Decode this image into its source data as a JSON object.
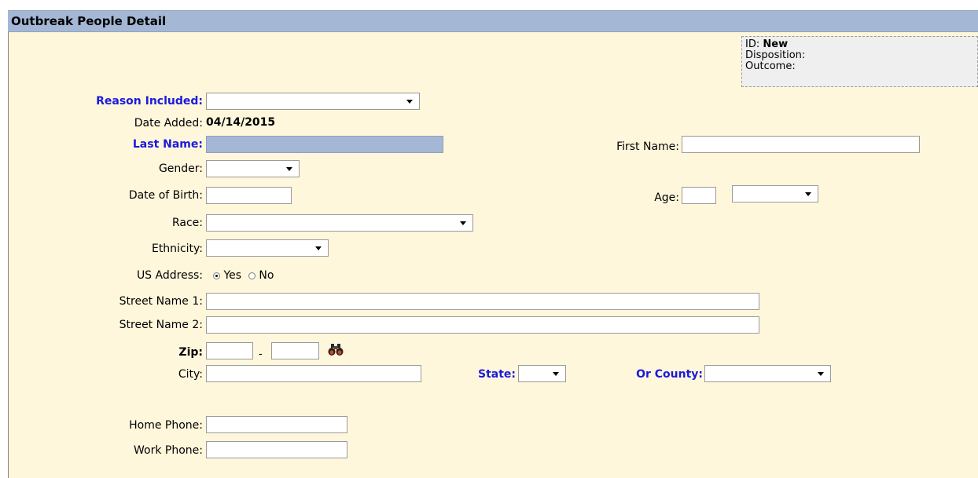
{
  "panel": {
    "title": "Outbreak People Detail"
  },
  "info": {
    "id_label": "ID:",
    "id_value": "New",
    "disposition_label": "Disposition:",
    "outcome_label": "Outcome:"
  },
  "form": {
    "reason_included": {
      "label": "Reason Included:",
      "value": ""
    },
    "date_added": {
      "label": "Date Added:",
      "value": "04/14/2015"
    },
    "last_name": {
      "label": "Last Name:",
      "value": ""
    },
    "first_name": {
      "label": "First Name:",
      "value": ""
    },
    "gender": {
      "label": "Gender:",
      "value": ""
    },
    "dob": {
      "label": "Date of Birth:",
      "value": ""
    },
    "age": {
      "label": "Age:",
      "value": "",
      "unit_value": ""
    },
    "race": {
      "label": "Race:",
      "value": ""
    },
    "ethnicity": {
      "label": "Ethnicity:",
      "value": ""
    },
    "us_address": {
      "label": "US Address:",
      "yes": "Yes",
      "no": "No",
      "selected": "Yes"
    },
    "street1": {
      "label": "Street Name 1:",
      "value": ""
    },
    "street2": {
      "label": "Street Name 2:",
      "value": ""
    },
    "zip": {
      "label": "Zip:",
      "value": "",
      "ext": "",
      "separator": "-"
    },
    "city": {
      "label": "City:",
      "value": ""
    },
    "state": {
      "label": "State:",
      "value": ""
    },
    "county": {
      "label": "Or County:",
      "value": ""
    },
    "home_phone": {
      "label": "Home Phone:",
      "value": ""
    },
    "work_phone": {
      "label": "Work Phone:",
      "value": ""
    }
  },
  "icons": {
    "zip_lookup": "binoculars-icon"
  },
  "colors": {
    "panel_bg": "#fff7dc",
    "titlebar_bg": "#a4b8d6",
    "required_label": "#1a1adc"
  }
}
